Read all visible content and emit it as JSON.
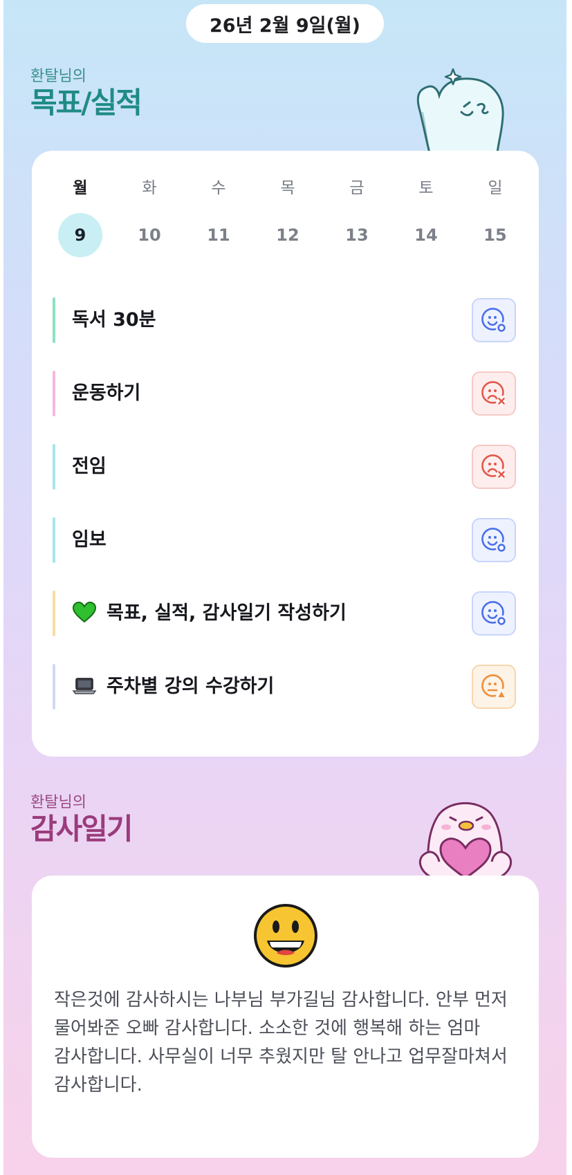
{
  "date_label": "26년 2월 9일(월)",
  "goals_section": {
    "owner": "환탈님의",
    "title": "목표/실적"
  },
  "week": [
    {
      "dow": "월",
      "num": "9",
      "active": true
    },
    {
      "dow": "화",
      "num": "10",
      "active": false
    },
    {
      "dow": "수",
      "num": "11",
      "active": false
    },
    {
      "dow": "목",
      "num": "12",
      "active": false
    },
    {
      "dow": "금",
      "num": "13",
      "active": false
    },
    {
      "dow": "토",
      "num": "14",
      "active": false
    },
    {
      "dow": "일",
      "num": "15",
      "active": false
    }
  ],
  "tasks": [
    {
      "label": "독서 30분",
      "bar_color": "#8fe0c0",
      "status": "done",
      "emoji": ""
    },
    {
      "label": "운동하기",
      "bar_color": "#f6b7de",
      "status": "fail",
      "emoji": ""
    },
    {
      "label": "전임",
      "bar_color": "#a8e4ef",
      "status": "fail",
      "emoji": ""
    },
    {
      "label": "임보",
      "bar_color": "#a8e4ef",
      "status": "done",
      "emoji": ""
    },
    {
      "label": "목표, 실적, 감사일기 작성하기",
      "bar_color": "#f8dca8",
      "status": "done",
      "emoji": "green-heart"
    },
    {
      "label": "주차별 강의 수강하기",
      "bar_color": "#cfd9f2",
      "status": "warn",
      "emoji": "laptop"
    }
  ],
  "status_colors": {
    "done": "#4a6fe8",
    "fail": "#e2574c",
    "warn": "#ef8e3b"
  },
  "gratitude_section": {
    "owner": "환탈님의",
    "title": "감사일기",
    "mood_icon": "grinning-face",
    "text": "작은것에 감사하시는 나부님 부가길님 감사합니다. 안부 먼저 물어봐준 오빠 감사합니다. 소소한 것에 행복해 하는 엄마 감사합니다. 사무실이 너무 추웠지만 탈 안나고 업무잘마쳐서 감사합니다."
  },
  "mascots": {
    "goals": "ghost-mascot",
    "gratitude": "bird-mascot"
  }
}
